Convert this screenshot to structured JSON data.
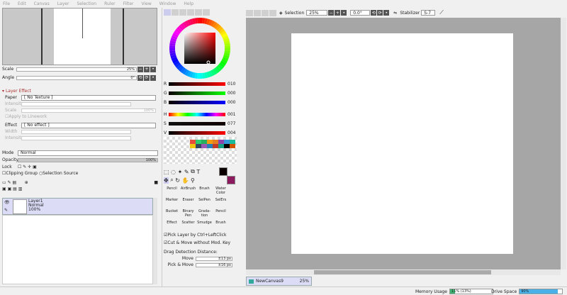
{
  "menu": [
    "File",
    "Edit",
    "Canvas",
    "Layer",
    "Selection",
    "Ruler",
    "Filter",
    "View",
    "Window",
    "Help"
  ],
  "navigator": {
    "scale_label": "Scale",
    "scale_value": "25%",
    "angle_label": "Angle",
    "angle_value": "0°"
  },
  "layer_effect": {
    "header": "Layer Effect",
    "paper_label": "Paper",
    "paper_value": "[ No Texture ]",
    "intensity_label": "Intensity",
    "scale_label": "Scale",
    "scale_value": "100%",
    "apply_linework": "Apply to Linework",
    "effect_label": "Effect",
    "effect_value": "[ No effect ]",
    "width_label": "Width",
    "intensity2_label": "Intensity"
  },
  "layer_props": {
    "mode_label": "Mode",
    "mode_value": "Normal",
    "opacity_label": "Opacity",
    "opacity_value": "100%",
    "lock_label": "Lock",
    "clipping": "Clipping Group",
    "selsource": "Selection Source"
  },
  "layers": [
    {
      "name": "Layer1",
      "mode": "Normal",
      "opacity": "100%"
    }
  ],
  "color": {
    "r_label": "R",
    "r": "010",
    "g_label": "G",
    "g": "000",
    "b_label": "B",
    "b": "000",
    "h_label": "H",
    "h": "001",
    "s_label": "S",
    "s": "077",
    "v_label": "V",
    "v": "004",
    "fg": "#0a0000",
    "bg": "#8b1a5e"
  },
  "swatches": [
    "#e74c3c",
    "#2ecc71",
    "#27ae60",
    "#f39c12",
    "#e67e22",
    "#8e44ad",
    "#3498db",
    "#1abc9c",
    "#f1c40f",
    "#34495e",
    "#9b59b6",
    "#2980b9",
    "#c0392b",
    "#16a085",
    "#000000",
    "#d35400"
  ],
  "tools": [
    [
      "Pencil",
      "AirBrush",
      "Brush",
      "Water Color"
    ],
    [
      "Marker",
      "Eraser",
      "SelPen",
      "SelErs"
    ],
    [
      "Bucket",
      "Binary Pen",
      "Grada- tion",
      "Pencil"
    ],
    [
      "Effect",
      "Scatter",
      "Smudge",
      "Brush"
    ]
  ],
  "options": {
    "pick_layer": "Pick Layer by Ctrl+LeftClick",
    "cut_move": "Cut & Move without Mod. Key",
    "drag_title": "Drag Detection Distance:",
    "move_label": "Move",
    "move_value": "±13 px",
    "pick_label": "Pick & Move",
    "pick_value": "±16 px"
  },
  "toolbar": {
    "selection_label": "Selection",
    "zoom": "25%",
    "angle": "0.0°",
    "stabilizer_label": "Stabilizer",
    "stabilizer": "S-7"
  },
  "canvas_tab": {
    "name": "NewCanvas9",
    "zoom": "25%"
  },
  "status": {
    "mem_label": "Memory Usage",
    "mem_value": "11% (13%)",
    "mem_fill": 0.11,
    "disk_label": "Drive Space",
    "disk_value": "90%",
    "disk_fill": 0.9
  }
}
